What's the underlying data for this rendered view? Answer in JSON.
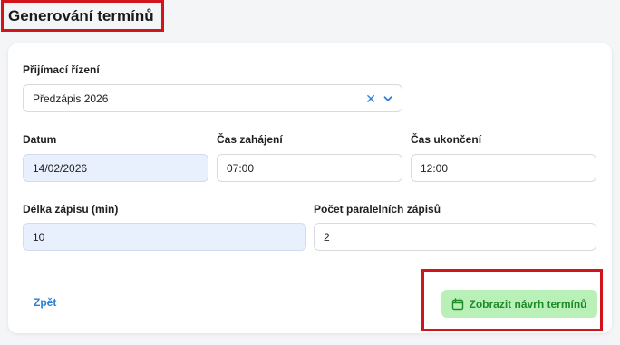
{
  "header": {
    "title": "Generování termínů"
  },
  "form": {
    "admission": {
      "label": "Přijímací řízení",
      "value": "Předzápis 2026"
    },
    "date": {
      "label": "Datum",
      "value": "14/02/2026"
    },
    "start_time": {
      "label": "Čas zahájení",
      "value": "07:00"
    },
    "end_time": {
      "label": "Čas ukončení",
      "value": "12:00"
    },
    "duration": {
      "label": "Délka zápisu (min)",
      "value": "10"
    },
    "parallel": {
      "label": "Počet paralelních zápisů",
      "value": "2"
    }
  },
  "actions": {
    "back_label": "Zpět",
    "generate_label": "Zobrazit návrh termínů"
  },
  "icons": {
    "clear": "close-icon",
    "dropdown": "chevron-down-icon",
    "generate": "calendar-icon"
  },
  "colors": {
    "accent": "#2a7fd4",
    "highlight_border": "#d0161c",
    "primary_button_bg": "#b8f0b8",
    "primary_button_text": "#1f8a2a",
    "filled_field_bg": "#e8effd"
  }
}
